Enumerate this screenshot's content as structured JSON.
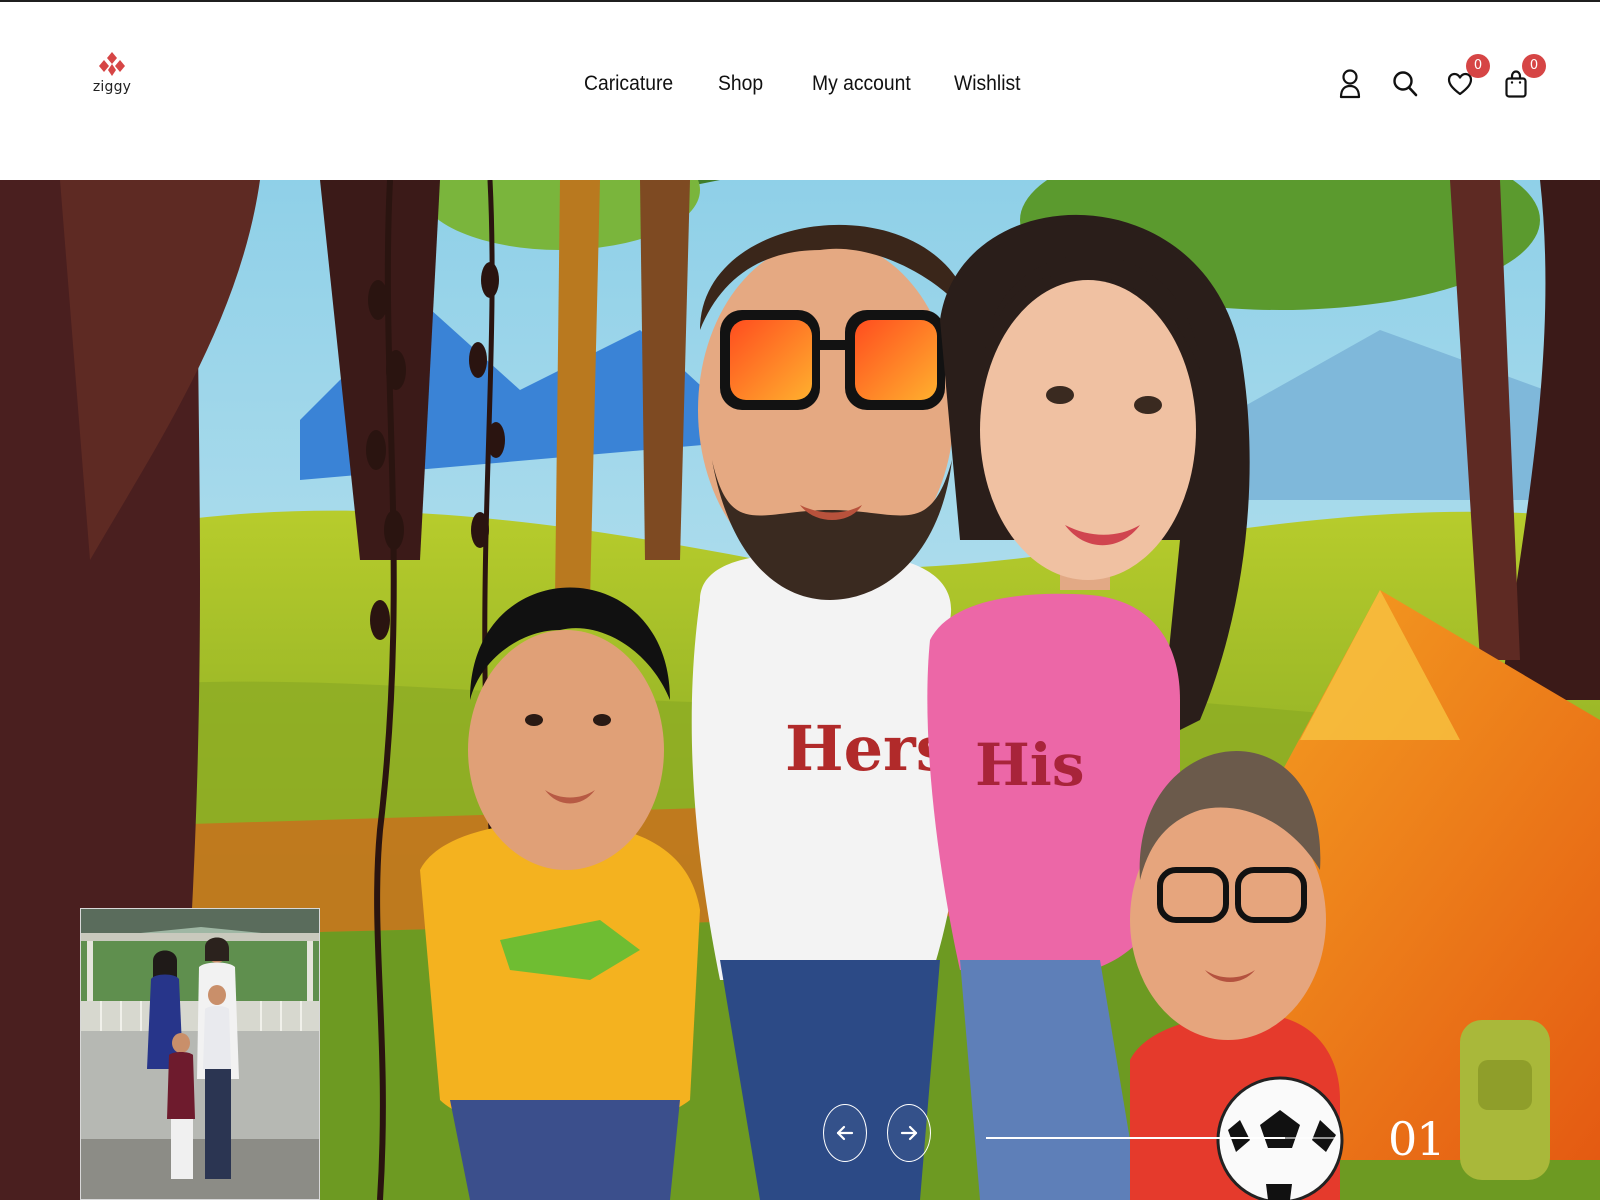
{
  "brand": {
    "logo_text": "ziggy",
    "logo_icon": "red-diamond-cluster-icon",
    "accent_color": "#d64545"
  },
  "nav": {
    "items": [
      {
        "label": "Caricature"
      },
      {
        "label": "Shop"
      },
      {
        "label": "My account"
      },
      {
        "label": "Wishlist"
      }
    ]
  },
  "header_icons": {
    "account_icon": "user-icon",
    "search_icon": "search-icon",
    "wishlist_icon": "heart-icon",
    "wishlist_count": "0",
    "cart_icon": "shopping-bag-icon",
    "cart_count": "0"
  },
  "hero": {
    "shirt_left_text": "Hers",
    "shirt_right_text": "His",
    "slide_number": "01",
    "slide_progress": 0.85,
    "prev_icon": "arrow-left-icon",
    "next_icon": "arrow-right-icon"
  }
}
